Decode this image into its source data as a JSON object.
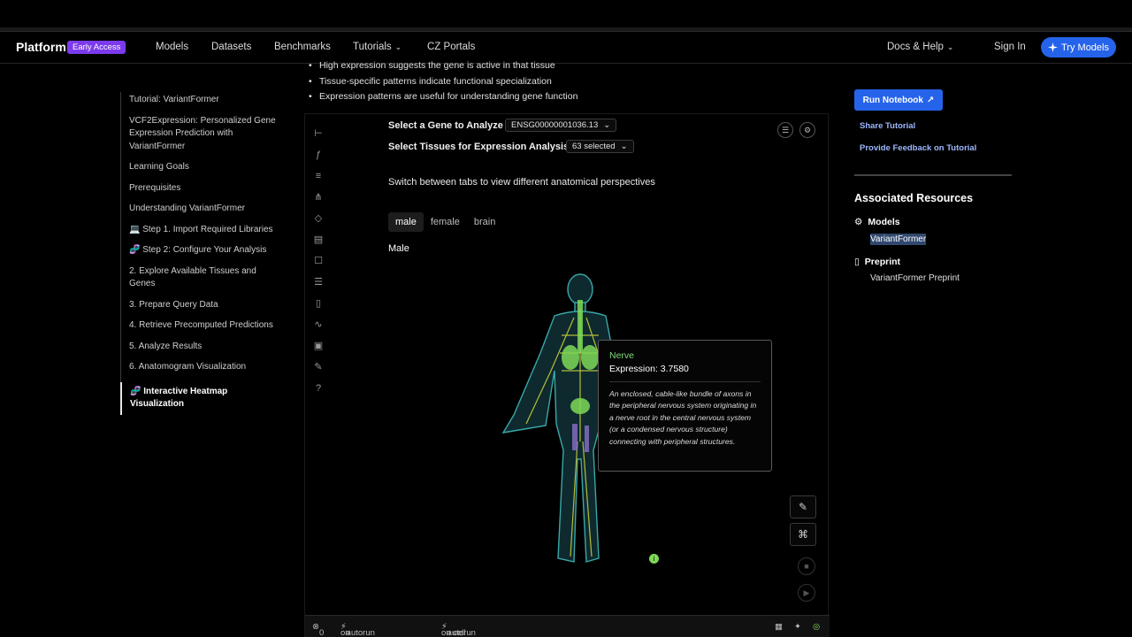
{
  "nav": {
    "brand": "Platform",
    "badge": "Early Access",
    "items": [
      "Models",
      "Datasets",
      "Benchmarks",
      "Tutorials",
      "CZ Portals"
    ],
    "docs": "Docs & Help",
    "signin": "Sign In",
    "try": "Try Models"
  },
  "toc": [
    "Tutorial: VariantFormer",
    "VCF2Expression: Personalized Gene Expression Prediction with VariantFormer",
    "Learning Goals",
    "Prerequisites",
    "Understanding VariantFormer",
    "💻 Step 1. Import Required Libraries",
    "🧬 Step 2: Configure Your Analysis",
    "2. Explore Available Tissues and Genes",
    "3. Prepare Query Data",
    "4. Retrieve Precomputed Predictions",
    "5. Analyze Results",
    "6. Anatomogram Visualization",
    "🧬 Interactive Heatmap Visualization"
  ],
  "bullets": [
    "High expression suggests the gene is active in that tissue",
    "Tissue-specific patterns indicate functional specialization",
    "Expression patterns are useful for understanding gene function"
  ],
  "cell": {
    "gene_label": "Select a Gene to Analyze",
    "gene_value": "ENSG00000001036.13",
    "tissue_label": "Select Tissues for Expression Analysis",
    "tissue_value": "63 selected",
    "switch_text": "Switch between tabs to view different anatomical perspectives",
    "tabs": [
      "male",
      "female",
      "brain"
    ],
    "view_title": "Male",
    "footer": {
      "errors": "0",
      "startup_label": "on startup:",
      "startup_value": "autorun",
      "change_label": "on cell change:",
      "change_value": "autorun"
    }
  },
  "tooltip": {
    "name": "Nerve",
    "expression": "Expression: 3.7580",
    "description": "An enclosed, cable-like bundle of axons in the peripheral nervous system originating in a nerve root in the central nervous system (or a condensed nervous structure) connecting with peripheral structures."
  },
  "right": {
    "run": "Run Notebook",
    "share": "Share Tutorial",
    "feedback": "Provide Feedback on Tutorial",
    "assoc": "Associated Resources",
    "models_head": "Models",
    "models_value": "VariantFormer",
    "preprint_head": "Preprint",
    "preprint_value": "VariantFormer Preprint"
  },
  "colors": {
    "accent": "#2563eb",
    "badge": "#7c3aed",
    "nerve": "#7dd87a"
  }
}
